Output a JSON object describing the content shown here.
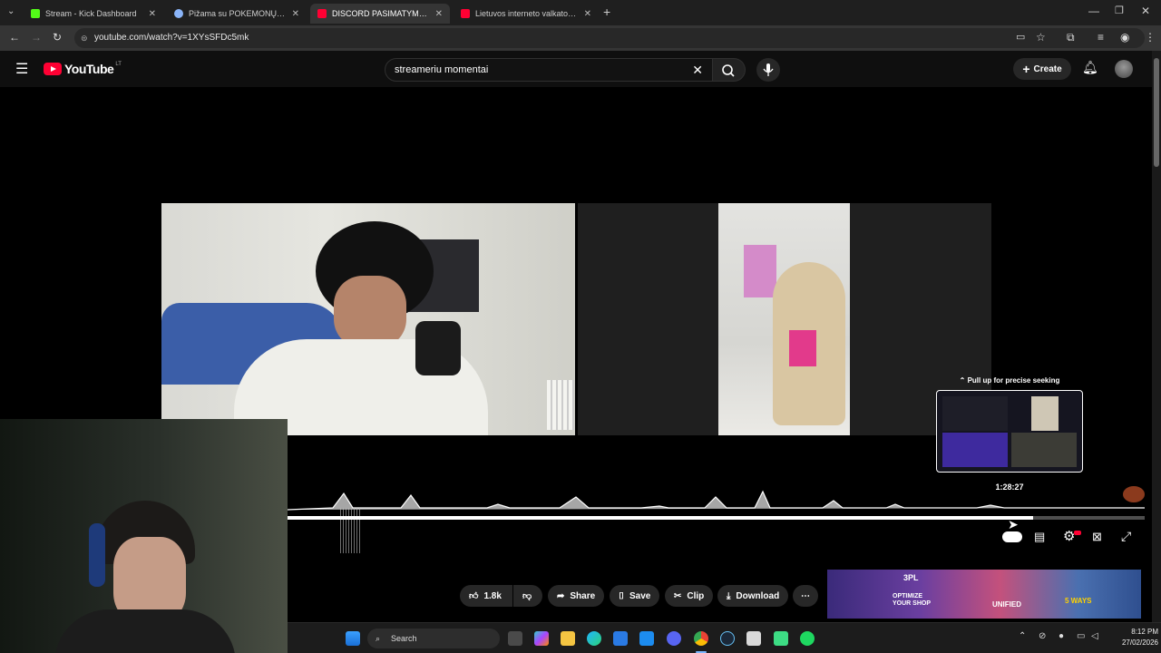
{
  "browser": {
    "tabs": [
      {
        "title": "Stream - Kick Dashboard",
        "color": "#53fc18"
      },
      {
        "title": "Pižama su POKEMONŲ motyv",
        "color": "#8ab4f8"
      },
      {
        "title": "DISCORD PASIMATYMAS SU O",
        "color": "#ff0033"
      },
      {
        "title": "Lietuvos interneto valkatos - Yo",
        "color": "#ff0033"
      }
    ],
    "url": "youtube.com/watch?v=1XYsSFDc5mk"
  },
  "youtube": {
    "logo_text": "YouTube",
    "region": "LT",
    "search_value": "streameriu momentai",
    "create_label": "Create"
  },
  "player": {
    "seek_hint": "Pull up for precise seeking",
    "preview_time": "1:28:27",
    "progress_fraction": 0.87
  },
  "actions": {
    "likes": "1.8k",
    "share": "Share",
    "save": "Save",
    "clip": "Clip",
    "download": "Download"
  },
  "ad_tiles": [
    "3PL",
    "OPTIMIZE YOUR SHOP",
    "UNIFIED",
    "5 WAYS"
  ],
  "taskbar": {
    "search_label": "Search",
    "time": "8:12 PM",
    "date": "27/02/2026"
  },
  "colors": {
    "yt_red": "#ff0033",
    "yt_bg": "#0f0f0f",
    "kick_green": "#53fc18"
  }
}
